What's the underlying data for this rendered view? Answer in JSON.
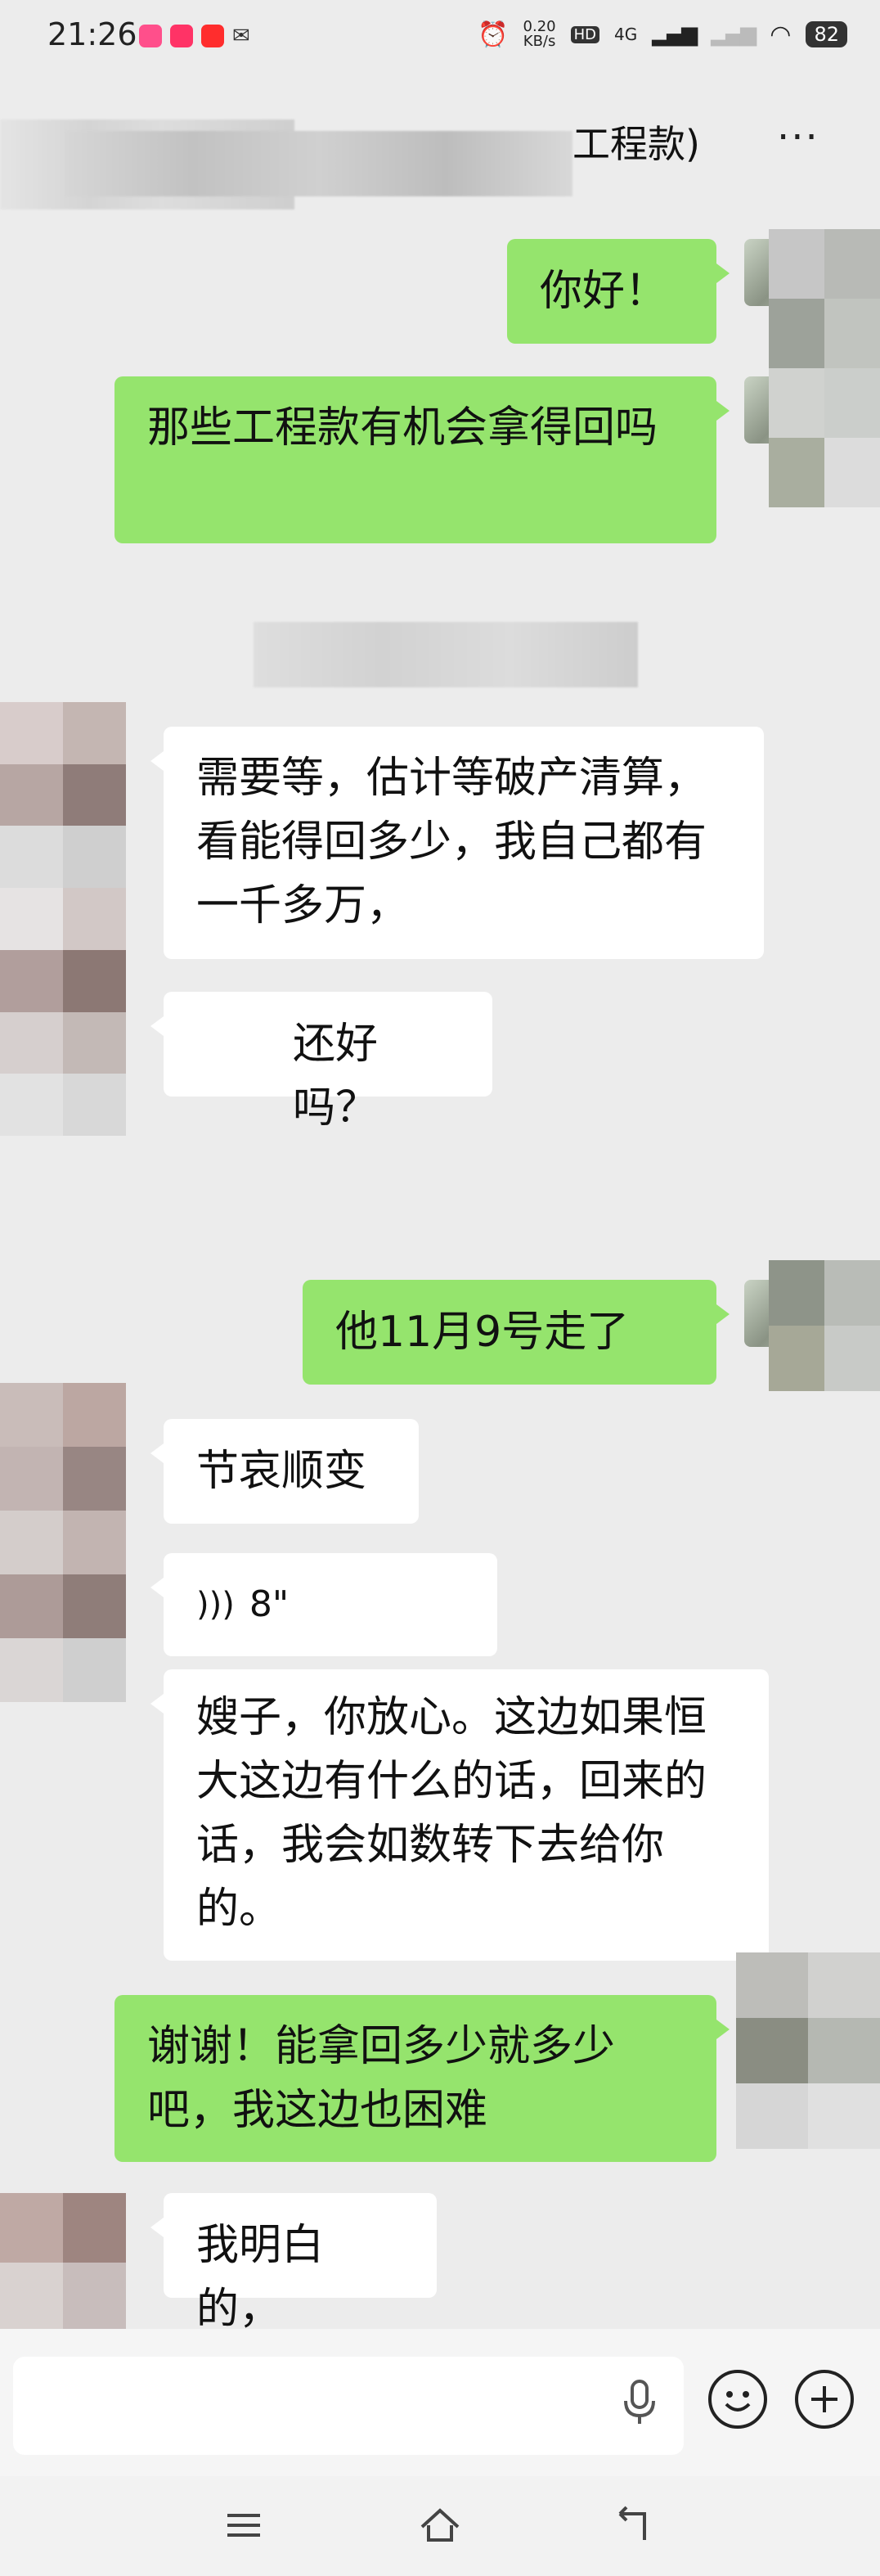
{
  "status": {
    "time": "21:26",
    "speed_value": "0.20",
    "speed_unit": "KB/s",
    "hd": "HD",
    "network": "4G",
    "battery": "82"
  },
  "header": {
    "title_visible": "工程款)",
    "more": "···"
  },
  "messages": [
    {
      "side": "me",
      "text": "你好！"
    },
    {
      "side": "me",
      "text": "那些工程款有机会拿得回吗"
    },
    {
      "side": "them",
      "text": "需要等，估计等破产清算，看能得回多少，我自己都有一千多万，"
    },
    {
      "side": "them",
      "text": "还好吗？"
    },
    {
      "side": "me",
      "text": "他11月9号走了"
    },
    {
      "side": "them",
      "text": "节哀顺变"
    },
    {
      "side": "them",
      "type": "voice",
      "text": "8\""
    },
    {
      "side": "them",
      "text": "嫂子，你放心。这边如果恒大这边有什么的话，回来的话，我会如数转下去给你的。"
    },
    {
      "side": "me",
      "text": "谢谢！能拿回多少就多少吧，我这边也困难"
    },
    {
      "side": "them",
      "text": "我明白的，"
    }
  ],
  "colors": {
    "me_bubble": "#95e46d",
    "them_bubble": "#ffffff",
    "background": "#ececec"
  }
}
